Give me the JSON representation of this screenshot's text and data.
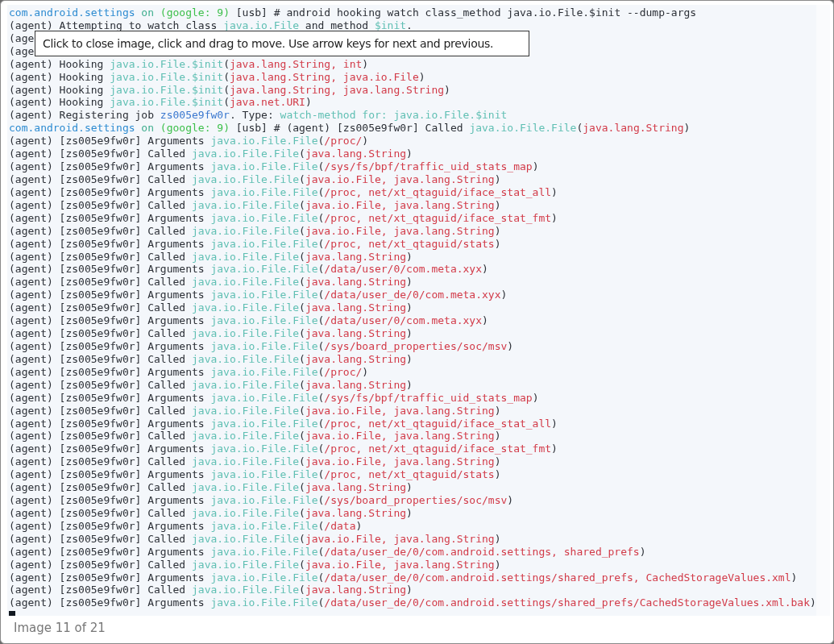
{
  "terminal": {
    "lines": [
      {
        "segments": [
          {
            "kind": "host",
            "text": "com.android.settings"
          },
          {
            "kind": "on",
            "text": " on "
          },
          {
            "kind": "device",
            "text": "(google: 9)"
          },
          {
            "kind": "plain",
            "text": " [usb] # android hooking watch class_method java.io.File.$init --dump-args"
          }
        ]
      },
      {
        "segments": [
          {
            "kind": "plain",
            "text": "(agent) Attempting to watch class "
          },
          {
            "kind": "class",
            "text": "java.io.File"
          },
          {
            "kind": "plain",
            "text": " and method "
          },
          {
            "kind": "class",
            "text": "$init"
          },
          {
            "kind": "plain",
            "text": "."
          }
        ]
      },
      {
        "segments": [
          {
            "kind": "plain",
            "text": "(age"
          }
        ]
      },
      {
        "segments": [
          {
            "kind": "plain",
            "text": "(age"
          }
        ]
      },
      {
        "segments": [
          {
            "kind": "plain",
            "text": "(agent) Hooking "
          },
          {
            "kind": "class",
            "text": "java.io.File.$init"
          },
          {
            "kind": "plain",
            "text": "("
          },
          {
            "kind": "args",
            "text": "java.lang.String, int"
          },
          {
            "kind": "plain",
            "text": ")"
          }
        ]
      },
      {
        "segments": [
          {
            "kind": "plain",
            "text": "(agent) Hooking "
          },
          {
            "kind": "class",
            "text": "java.io.File.$init"
          },
          {
            "kind": "plain",
            "text": "("
          },
          {
            "kind": "args",
            "text": "java.lang.String, java.io.File"
          },
          {
            "kind": "plain",
            "text": ")"
          }
        ]
      },
      {
        "segments": [
          {
            "kind": "plain",
            "text": "(agent) Hooking "
          },
          {
            "kind": "class",
            "text": "java.io.File.$init"
          },
          {
            "kind": "plain",
            "text": "("
          },
          {
            "kind": "args",
            "text": "java.lang.String, java.lang.String"
          },
          {
            "kind": "plain",
            "text": ")"
          }
        ]
      },
      {
        "segments": [
          {
            "kind": "plain",
            "text": "(agent) Hooking "
          },
          {
            "kind": "class",
            "text": "java.io.File.$init"
          },
          {
            "kind": "plain",
            "text": "("
          },
          {
            "kind": "args",
            "text": "java.net.URI"
          },
          {
            "kind": "plain",
            "text": ")"
          }
        ]
      },
      {
        "segments": [
          {
            "kind": "plain",
            "text": "(agent) Registering job "
          },
          {
            "kind": "job",
            "text": "zs005e9fw0r"
          },
          {
            "kind": "plain",
            "text": ". Type: "
          },
          {
            "kind": "class",
            "text": "watch-method for: java.io.File.$init"
          }
        ]
      },
      {
        "segments": [
          {
            "kind": "host",
            "text": "com.android.settings"
          },
          {
            "kind": "on",
            "text": " on "
          },
          {
            "kind": "device",
            "text": "(google: 9)"
          },
          {
            "kind": "plain",
            "text": " [usb] # (agent) [zs005e9fw0r] Called "
          },
          {
            "kind": "class",
            "text": "java.io.File.File"
          },
          {
            "kind": "plain",
            "text": "("
          },
          {
            "kind": "args",
            "text": "java.lang.String"
          },
          {
            "kind": "plain",
            "text": ")"
          }
        ]
      },
      {
        "segments": [
          {
            "kind": "plain",
            "text": "(agent) [zs005e9fw0r] Arguments "
          },
          {
            "kind": "class",
            "text": "java.io.File.File"
          },
          {
            "kind": "plain",
            "text": "("
          },
          {
            "kind": "args",
            "text": "/proc/"
          },
          {
            "kind": "plain",
            "text": ")"
          }
        ]
      },
      {
        "segments": [
          {
            "kind": "plain",
            "text": "(agent) [zs005e9fw0r] Called "
          },
          {
            "kind": "class",
            "text": "java.io.File.File"
          },
          {
            "kind": "plain",
            "text": "("
          },
          {
            "kind": "args",
            "text": "java.lang.String"
          },
          {
            "kind": "plain",
            "text": ")"
          }
        ]
      },
      {
        "segments": [
          {
            "kind": "plain",
            "text": "(agent) [zs005e9fw0r] Arguments "
          },
          {
            "kind": "class",
            "text": "java.io.File.File"
          },
          {
            "kind": "plain",
            "text": "("
          },
          {
            "kind": "args",
            "text": "/sys/fs/bpf/traffic_uid_stats_map"
          },
          {
            "kind": "plain",
            "text": ")"
          }
        ]
      },
      {
        "segments": [
          {
            "kind": "plain",
            "text": "(agent) [zs005e9fw0r] Called "
          },
          {
            "kind": "class",
            "text": "java.io.File.File"
          },
          {
            "kind": "plain",
            "text": "("
          },
          {
            "kind": "args",
            "text": "java.io.File, java.lang.String"
          },
          {
            "kind": "plain",
            "text": ")"
          }
        ]
      },
      {
        "segments": [
          {
            "kind": "plain",
            "text": "(agent) [zs005e9fw0r] Arguments "
          },
          {
            "kind": "class",
            "text": "java.io.File.File"
          },
          {
            "kind": "plain",
            "text": "("
          },
          {
            "kind": "args",
            "text": "/proc, net/xt_qtaguid/iface_stat_all"
          },
          {
            "kind": "plain",
            "text": ")"
          }
        ]
      },
      {
        "segments": [
          {
            "kind": "plain",
            "text": "(agent) [zs005e9fw0r] Called "
          },
          {
            "kind": "class",
            "text": "java.io.File.File"
          },
          {
            "kind": "plain",
            "text": "("
          },
          {
            "kind": "args",
            "text": "java.io.File, java.lang.String"
          },
          {
            "kind": "plain",
            "text": ")"
          }
        ]
      },
      {
        "segments": [
          {
            "kind": "plain",
            "text": "(agent) [zs005e9fw0r] Arguments "
          },
          {
            "kind": "class",
            "text": "java.io.File.File"
          },
          {
            "kind": "plain",
            "text": "("
          },
          {
            "kind": "args",
            "text": "/proc, net/xt_qtaguid/iface_stat_fmt"
          },
          {
            "kind": "plain",
            "text": ")"
          }
        ]
      },
      {
        "segments": [
          {
            "kind": "plain",
            "text": "(agent) [zs005e9fw0r] Called "
          },
          {
            "kind": "class",
            "text": "java.io.File.File"
          },
          {
            "kind": "plain",
            "text": "("
          },
          {
            "kind": "args",
            "text": "java.io.File, java.lang.String"
          },
          {
            "kind": "plain",
            "text": ")"
          }
        ]
      },
      {
        "segments": [
          {
            "kind": "plain",
            "text": "(agent) [zs005e9fw0r] Arguments "
          },
          {
            "kind": "class",
            "text": "java.io.File.File"
          },
          {
            "kind": "plain",
            "text": "("
          },
          {
            "kind": "args",
            "text": "/proc, net/xt_qtaguid/stats"
          },
          {
            "kind": "plain",
            "text": ")"
          }
        ]
      },
      {
        "segments": [
          {
            "kind": "plain",
            "text": "(agent) [zs005e9fw0r] Called "
          },
          {
            "kind": "class",
            "text": "java.io.File.File"
          },
          {
            "kind": "plain",
            "text": "("
          },
          {
            "kind": "args",
            "text": "java.lang.String"
          },
          {
            "kind": "plain",
            "text": ")"
          }
        ]
      },
      {
        "segments": [
          {
            "kind": "plain",
            "text": "(agent) [zs005e9fw0r] Arguments "
          },
          {
            "kind": "class",
            "text": "java.io.File.File"
          },
          {
            "kind": "plain",
            "text": "("
          },
          {
            "kind": "args",
            "text": "/data/user/0/com.meta.xyx"
          },
          {
            "kind": "plain",
            "text": ")"
          }
        ]
      },
      {
        "segments": [
          {
            "kind": "plain",
            "text": "(agent) [zs005e9fw0r] Called "
          },
          {
            "kind": "class",
            "text": "java.io.File.File"
          },
          {
            "kind": "plain",
            "text": "("
          },
          {
            "kind": "args",
            "text": "java.lang.String"
          },
          {
            "kind": "plain",
            "text": ")"
          }
        ]
      },
      {
        "segments": [
          {
            "kind": "plain",
            "text": "(agent) [zs005e9fw0r] Arguments "
          },
          {
            "kind": "class",
            "text": "java.io.File.File"
          },
          {
            "kind": "plain",
            "text": "("
          },
          {
            "kind": "args",
            "text": "/data/user_de/0/com.meta.xyx"
          },
          {
            "kind": "plain",
            "text": ")"
          }
        ]
      },
      {
        "segments": [
          {
            "kind": "plain",
            "text": "(agent) [zs005e9fw0r] Called "
          },
          {
            "kind": "class",
            "text": "java.io.File.File"
          },
          {
            "kind": "plain",
            "text": "("
          },
          {
            "kind": "args",
            "text": "java.lang.String"
          },
          {
            "kind": "plain",
            "text": ")"
          }
        ]
      },
      {
        "segments": [
          {
            "kind": "plain",
            "text": "(agent) [zs005e9fw0r] Arguments "
          },
          {
            "kind": "class",
            "text": "java.io.File.File"
          },
          {
            "kind": "plain",
            "text": "("
          },
          {
            "kind": "args",
            "text": "/data/user/0/com.meta.xyx"
          },
          {
            "kind": "plain",
            "text": ")"
          }
        ]
      },
      {
        "segments": [
          {
            "kind": "plain",
            "text": "(agent) [zs005e9fw0r] Called "
          },
          {
            "kind": "class",
            "text": "java.io.File.File"
          },
          {
            "kind": "plain",
            "text": "("
          },
          {
            "kind": "args",
            "text": "java.lang.String"
          },
          {
            "kind": "plain",
            "text": ")"
          }
        ]
      },
      {
        "segments": [
          {
            "kind": "plain",
            "text": "(agent) [zs005e9fw0r] Arguments "
          },
          {
            "kind": "class",
            "text": "java.io.File.File"
          },
          {
            "kind": "plain",
            "text": "("
          },
          {
            "kind": "args",
            "text": "/sys/board_properties/soc/msv"
          },
          {
            "kind": "plain",
            "text": ")"
          }
        ]
      },
      {
        "segments": [
          {
            "kind": "plain",
            "text": "(agent) [zs005e9fw0r] Called "
          },
          {
            "kind": "class",
            "text": "java.io.File.File"
          },
          {
            "kind": "plain",
            "text": "("
          },
          {
            "kind": "args",
            "text": "java.lang.String"
          },
          {
            "kind": "plain",
            "text": ")"
          }
        ]
      },
      {
        "segments": [
          {
            "kind": "plain",
            "text": "(agent) [zs005e9fw0r] Arguments "
          },
          {
            "kind": "class",
            "text": "java.io.File.File"
          },
          {
            "kind": "plain",
            "text": "("
          },
          {
            "kind": "args",
            "text": "/proc/"
          },
          {
            "kind": "plain",
            "text": ")"
          }
        ]
      },
      {
        "segments": [
          {
            "kind": "plain",
            "text": "(agent) [zs005e9fw0r] Called "
          },
          {
            "kind": "class",
            "text": "java.io.File.File"
          },
          {
            "kind": "plain",
            "text": "("
          },
          {
            "kind": "args",
            "text": "java.lang.String"
          },
          {
            "kind": "plain",
            "text": ")"
          }
        ]
      },
      {
        "segments": [
          {
            "kind": "plain",
            "text": "(agent) [zs005e9fw0r] Arguments "
          },
          {
            "kind": "class",
            "text": "java.io.File.File"
          },
          {
            "kind": "plain",
            "text": "("
          },
          {
            "kind": "args",
            "text": "/sys/fs/bpf/traffic_uid_stats_map"
          },
          {
            "kind": "plain",
            "text": ")"
          }
        ]
      },
      {
        "segments": [
          {
            "kind": "plain",
            "text": "(agent) [zs005e9fw0r] Called "
          },
          {
            "kind": "class",
            "text": "java.io.File.File"
          },
          {
            "kind": "plain",
            "text": "("
          },
          {
            "kind": "args",
            "text": "java.io.File, java.lang.String"
          },
          {
            "kind": "plain",
            "text": ")"
          }
        ]
      },
      {
        "segments": [
          {
            "kind": "plain",
            "text": "(agent) [zs005e9fw0r] Arguments "
          },
          {
            "kind": "class",
            "text": "java.io.File.File"
          },
          {
            "kind": "plain",
            "text": "("
          },
          {
            "kind": "args",
            "text": "/proc, net/xt_qtaguid/iface_stat_all"
          },
          {
            "kind": "plain",
            "text": ")"
          }
        ]
      },
      {
        "segments": [
          {
            "kind": "plain",
            "text": "(agent) [zs005e9fw0r] Called "
          },
          {
            "kind": "class",
            "text": "java.io.File.File"
          },
          {
            "kind": "plain",
            "text": "("
          },
          {
            "kind": "args",
            "text": "java.io.File, java.lang.String"
          },
          {
            "kind": "plain",
            "text": ")"
          }
        ]
      },
      {
        "segments": [
          {
            "kind": "plain",
            "text": "(agent) [zs005e9fw0r] Arguments "
          },
          {
            "kind": "class",
            "text": "java.io.File.File"
          },
          {
            "kind": "plain",
            "text": "("
          },
          {
            "kind": "args",
            "text": "/proc, net/xt_qtaguid/iface_stat_fmt"
          },
          {
            "kind": "plain",
            "text": ")"
          }
        ]
      },
      {
        "segments": [
          {
            "kind": "plain",
            "text": "(agent) [zs005e9fw0r] Called "
          },
          {
            "kind": "class",
            "text": "java.io.File.File"
          },
          {
            "kind": "plain",
            "text": "("
          },
          {
            "kind": "args",
            "text": "java.io.File, java.lang.String"
          },
          {
            "kind": "plain",
            "text": ")"
          }
        ]
      },
      {
        "segments": [
          {
            "kind": "plain",
            "text": "(agent) [zs005e9fw0r] Arguments "
          },
          {
            "kind": "class",
            "text": "java.io.File.File"
          },
          {
            "kind": "plain",
            "text": "("
          },
          {
            "kind": "args",
            "text": "/proc, net/xt_qtaguid/stats"
          },
          {
            "kind": "plain",
            "text": ")"
          }
        ]
      },
      {
        "segments": [
          {
            "kind": "plain",
            "text": "(agent) [zs005e9fw0r] Called "
          },
          {
            "kind": "class",
            "text": "java.io.File.File"
          },
          {
            "kind": "plain",
            "text": "("
          },
          {
            "kind": "args",
            "text": "java.lang.String"
          },
          {
            "kind": "plain",
            "text": ")"
          }
        ]
      },
      {
        "segments": [
          {
            "kind": "plain",
            "text": "(agent) [zs005e9fw0r] Arguments "
          },
          {
            "kind": "class",
            "text": "java.io.File.File"
          },
          {
            "kind": "plain",
            "text": "("
          },
          {
            "kind": "args",
            "text": "/sys/board_properties/soc/msv"
          },
          {
            "kind": "plain",
            "text": ")"
          }
        ]
      },
      {
        "segments": [
          {
            "kind": "plain",
            "text": "(agent) [zs005e9fw0r] Called "
          },
          {
            "kind": "class",
            "text": "java.io.File.File"
          },
          {
            "kind": "plain",
            "text": "("
          },
          {
            "kind": "args",
            "text": "java.lang.String"
          },
          {
            "kind": "plain",
            "text": ")"
          }
        ]
      },
      {
        "segments": [
          {
            "kind": "plain",
            "text": "(agent) [zs005e9fw0r] Arguments "
          },
          {
            "kind": "class",
            "text": "java.io.File.File"
          },
          {
            "kind": "plain",
            "text": "("
          },
          {
            "kind": "args",
            "text": "/data"
          },
          {
            "kind": "plain",
            "text": ")"
          }
        ]
      },
      {
        "segments": [
          {
            "kind": "plain",
            "text": "(agent) [zs005e9fw0r] Called "
          },
          {
            "kind": "class",
            "text": "java.io.File.File"
          },
          {
            "kind": "plain",
            "text": "("
          },
          {
            "kind": "args",
            "text": "java.io.File, java.lang.String"
          },
          {
            "kind": "plain",
            "text": ")"
          }
        ]
      },
      {
        "segments": [
          {
            "kind": "plain",
            "text": "(agent) [zs005e9fw0r] Arguments "
          },
          {
            "kind": "class",
            "text": "java.io.File.File"
          },
          {
            "kind": "plain",
            "text": "("
          },
          {
            "kind": "args",
            "text": "/data/user_de/0/com.android.settings, shared_prefs"
          },
          {
            "kind": "plain",
            "text": ")"
          }
        ]
      },
      {
        "segments": [
          {
            "kind": "plain",
            "text": "(agent) [zs005e9fw0r] Called "
          },
          {
            "kind": "class",
            "text": "java.io.File.File"
          },
          {
            "kind": "plain",
            "text": "("
          },
          {
            "kind": "args",
            "text": "java.io.File, java.lang.String"
          },
          {
            "kind": "plain",
            "text": ")"
          }
        ]
      },
      {
        "segments": [
          {
            "kind": "plain",
            "text": "(agent) [zs005e9fw0r] Arguments "
          },
          {
            "kind": "class",
            "text": "java.io.File.File"
          },
          {
            "kind": "plain",
            "text": "("
          },
          {
            "kind": "args",
            "text": "/data/user_de/0/com.android.settings/shared_prefs, CachedStorageValues.xml"
          },
          {
            "kind": "plain",
            "text": ")"
          }
        ]
      },
      {
        "segments": [
          {
            "kind": "plain",
            "text": "(agent) [zs005e9fw0r] Called "
          },
          {
            "kind": "class",
            "text": "java.io.File.File"
          },
          {
            "kind": "plain",
            "text": "("
          },
          {
            "kind": "args",
            "text": "java.lang.String"
          },
          {
            "kind": "plain",
            "text": ")"
          }
        ]
      },
      {
        "segments": [
          {
            "kind": "plain",
            "text": "(agent) [zs005e9fw0r] Arguments "
          },
          {
            "kind": "class",
            "text": "java.io.File.File"
          },
          {
            "kind": "plain",
            "text": "("
          },
          {
            "kind": "args",
            "text": "/data/user_de/0/com.android.settings/shared_prefs/CachedStorageValues.xml.bak"
          },
          {
            "kind": "plain",
            "text": ")"
          }
        ]
      }
    ]
  },
  "tooltip": {
    "text": "Click to close image, click and drag to move. Use arrow keys for next and previous."
  },
  "caption": "Image 11 of 21"
}
